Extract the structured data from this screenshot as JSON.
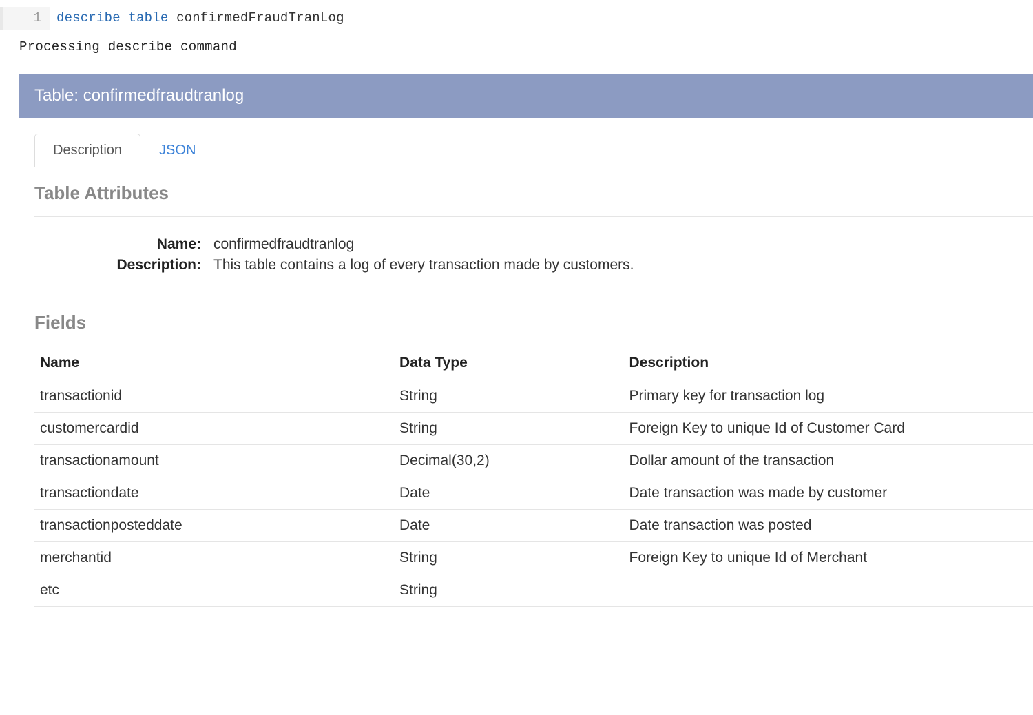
{
  "code": {
    "line_number": "1",
    "keyword1": "describe",
    "keyword2": "table",
    "identifier": "confirmedFraudTranLog"
  },
  "output_status": "Processing describe command",
  "panel": {
    "header": "Table: confirmedfraudtranlog",
    "tabs": [
      {
        "label": "Description",
        "active": true
      },
      {
        "label": "JSON",
        "active": false
      }
    ],
    "attributes_title": "Table Attributes",
    "attributes": {
      "name_label": "Name:",
      "name_value": "confirmedfraudtranlog",
      "description_label": "Description:",
      "description_value": "This table contains a log of every transaction made by customers."
    },
    "fields_title": "Fields",
    "fields_headers": {
      "name": "Name",
      "data_type": "Data Type",
      "description": "Description"
    },
    "fields": [
      {
        "name": "transactionid",
        "type": "String",
        "desc": "Primary key for transaction log"
      },
      {
        "name": "customercardid",
        "type": "String",
        "desc": "Foreign Key to unique Id of Customer Card"
      },
      {
        "name": "transactionamount",
        "type": "Decimal(30,2)",
        "desc": "Dollar amount of the transaction"
      },
      {
        "name": "transactiondate",
        "type": "Date",
        "desc": "Date transaction was made by customer"
      },
      {
        "name": "transactionposteddate",
        "type": "Date",
        "desc": "Date transaction was posted"
      },
      {
        "name": "merchantid",
        "type": "String",
        "desc": "Foreign Key to unique Id of Merchant"
      },
      {
        "name": "etc",
        "type": "String",
        "desc": ""
      }
    ]
  }
}
